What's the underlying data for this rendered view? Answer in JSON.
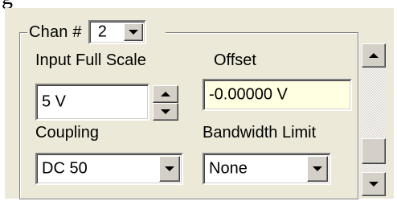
{
  "partial_text": "g",
  "channel": {
    "label": "Chan #",
    "value": "2"
  },
  "input_full_scale": {
    "label": "Input Full Scale",
    "value": "5 V"
  },
  "offset": {
    "label": "Offset",
    "value": "-0.00000 V",
    "background": "#ffffe1"
  },
  "coupling": {
    "label": "Coupling",
    "value": "DC 50"
  },
  "bandwidth_limit": {
    "label": "Bandwidth Limit",
    "value": "None"
  },
  "icons": {
    "dropdown": "chevron-down-icon",
    "spin_up": "arrow-up-icon",
    "spin_down": "arrow-down-icon",
    "scroll_up": "scroll-up-icon",
    "scroll_down": "scroll-down-icon"
  },
  "colors": {
    "panel_background": "#ece9d8",
    "control_background": "#ffffff",
    "button_face": "#d4d0c8"
  }
}
